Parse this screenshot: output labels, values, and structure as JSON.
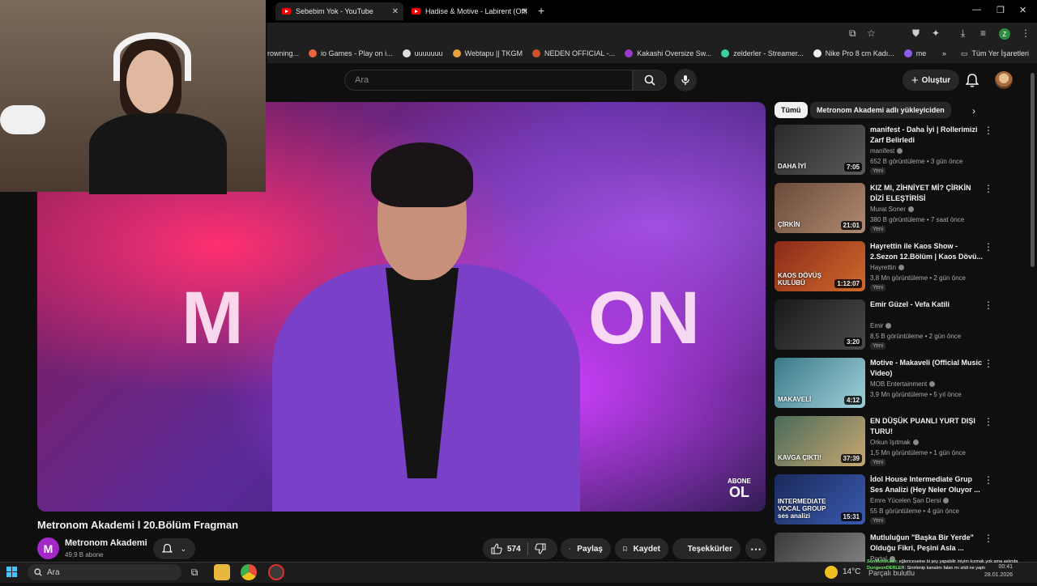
{
  "browser": {
    "tabs": [
      {
        "label": "Sebebim Yok - YouTube",
        "active": true
      },
      {
        "label": "Hadise & Motive - Labirent (Offi",
        "active": false
      }
    ],
    "bookmarks": [
      {
        "label": "rowning...",
        "color": "#888888"
      },
      {
        "label": "io Games - Play on i...",
        "color": "#e8643c"
      },
      {
        "label": "uuuuuuu",
        "color": "#dddddd"
      },
      {
        "label": "Webtapu || TKGM",
        "color": "#e8a03c"
      },
      {
        "label": "NEDEN OFFICIAL -...",
        "color": "#d0502a"
      },
      {
        "label": "Kakashi Oversize Sw...",
        "color": "#9a3cc8"
      },
      {
        "label": "zelderler - Streamer...",
        "color": "#3ccfa0"
      },
      {
        "label": "Nike Pro 8 cm Kadı...",
        "color": "#f0f0f0"
      },
      {
        "label": "me",
        "color": "#8a5cf0"
      }
    ],
    "all_bookmarks_label": "Tüm Yer İşaretleri",
    "profile_initial": "Z"
  },
  "youtube": {
    "search_placeholder": "Ara",
    "create_label": "Oluştur",
    "video": {
      "title": "Metronom Akademi l 20.Bölüm Fragman",
      "overlay_top": "ABONE",
      "overlay_bottom": "OL",
      "channel": "Metronom Akademi",
      "channel_initial": "M",
      "subscribers": "49,9 B abone",
      "likes": "574",
      "share_label": "Paylaş",
      "save_label": "Kaydet",
      "thanks_label": "Teşekkürler"
    },
    "chips": [
      "Tümü",
      "Metronom Akademi adlı yükleyiciden"
    ],
    "recommendations": [
      {
        "title": "manifest - Daha İyi | Rollerimizi Zarf Belirledi",
        "channel": "manifest",
        "views": "652 B görüntüleme • 3 gün önce",
        "badge": "Yeni",
        "duration": "7:05",
        "thumb_text": "DAHA İYİ",
        "colors": [
          "#2a2a2a",
          "#5a5a5a"
        ]
      },
      {
        "title": "KIZ MI, ZİHNİYET Mİ? ÇİRKİN DİZİ ELEŞTİRİSİ",
        "channel": "Murat Soner",
        "views": "380 B görüntüleme • 7 saat önce",
        "badge": "Yeni",
        "duration": "21:01",
        "thumb_text": "ÇİRKİN",
        "colors": [
          "#6a4a3a",
          "#b08a70"
        ]
      },
      {
        "title": "Hayrettin ile Kaos Show - 2.Sezon 12.Bölüm | Kaos Dövü...",
        "channel": "Hayrettin",
        "views": "3,8 Mn görüntüleme • 2 gün önce",
        "badge": "Yeni",
        "duration": "1:12:07",
        "thumb_text": "KAOS DÖVÜŞ KULÜBÜ",
        "colors": [
          "#8a2a1a",
          "#d06a2a"
        ]
      },
      {
        "title": "Emir Güzel - Vefa Katili",
        "channel": "Emir",
        "views": "8,5 B görüntüleme • 2 gün önce",
        "badge": "Yeni",
        "duration": "3:20",
        "thumb_text": "",
        "colors": [
          "#1a1a1a",
          "#4a4a4a"
        ]
      },
      {
        "title": "Motive - Makaveli (Official Music Video)",
        "channel": "MOB Entertainment",
        "views": "3,9 Mn görüntüleme • 5 yıl önce",
        "badge": "",
        "duration": "4:12",
        "thumb_text": "MAKAVELİ",
        "colors": [
          "#3a7a8a",
          "#a0d0d8"
        ]
      },
      {
        "title": "EN DÜŞÜK PUANLI YURT DIŞI TURU!",
        "channel": "Orkun Işıtmak",
        "views": "1,5 Mn görüntüleme • 1 gün önce",
        "badge": "Yeni",
        "duration": "37:39",
        "thumb_text": "KAVGA ÇIKTI!",
        "colors": [
          "#4a6a5a",
          "#c8a870"
        ]
      },
      {
        "title": "İdol House Intermediate Grup Ses Analizi (Hey Neler Oluyor ...",
        "channel": "Emre Yücelen Şan Dersi",
        "views": "55 B görüntüleme • 4 gün önce",
        "badge": "Yeni",
        "duration": "15:31",
        "thumb_text": "INTERMEDIATE VOCAL GROUP ses analizi",
        "colors": [
          "#1a2a5a",
          "#3a5ab0"
        ]
      },
      {
        "title": "Mutluluğun \"Başka Bir Yerde\" Olduğu Fikri, Peşini Asla ...",
        "channel": "Portal",
        "views": "",
        "badge": "",
        "duration": "",
        "thumb_text": "",
        "colors": [
          "#3a3a3a",
          "#8a8a8a"
        ]
      }
    ]
  },
  "taskbar": {
    "search_placeholder": "Ara",
    "temperature": "14°C",
    "weather_text": "Parçalı bulutlu",
    "time": "00:41",
    "date": "28.01.2026"
  },
  "stream_chat": [
    {
      "user": "SonMohiKaan",
      "text": ": eğlenceseine bi şey yapabilir miyim kızmak yok ama aslında"
    },
    {
      "user": "DungeonDERLER",
      "text": ": Sinirlenip kanalını falan mı sildi ne yaptı"
    }
  ]
}
